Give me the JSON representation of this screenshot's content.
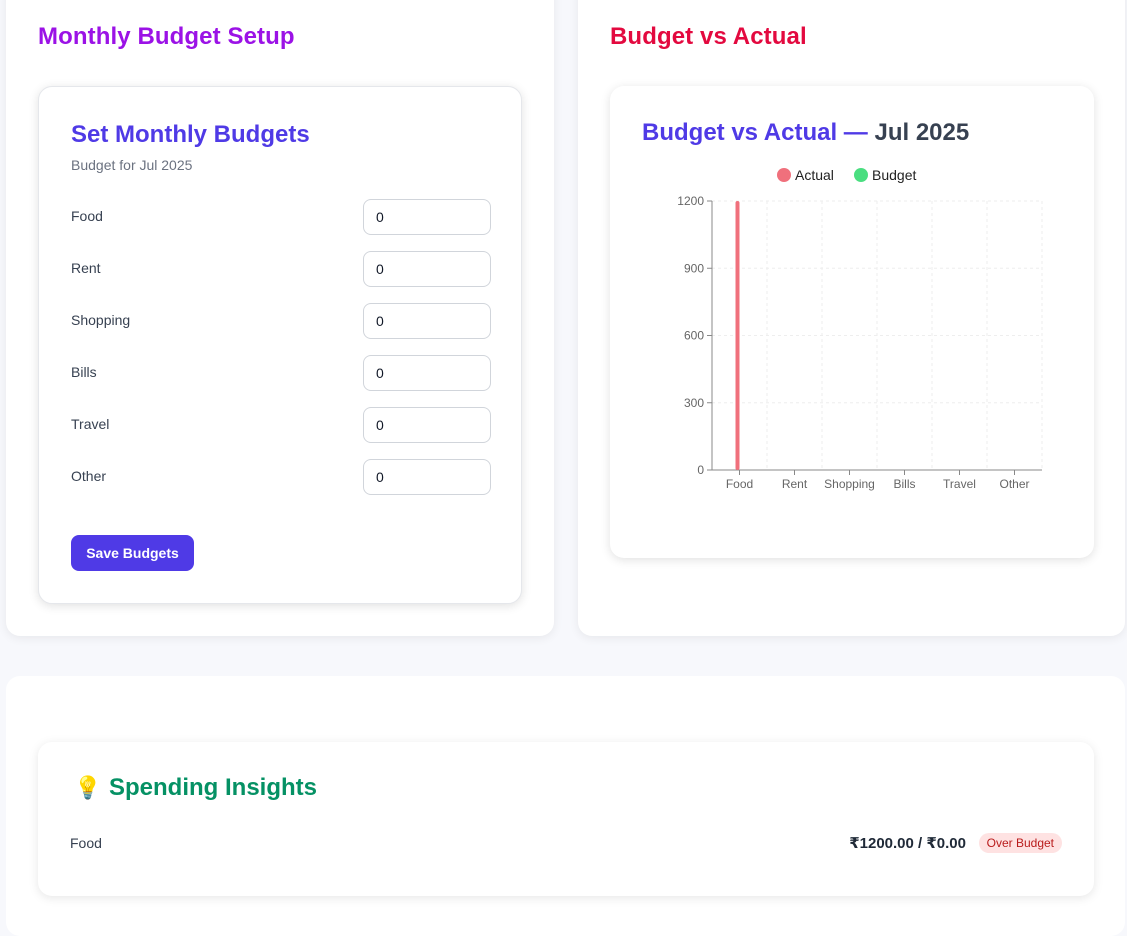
{
  "setup_panel": {
    "title": "Monthly Budget Setup",
    "card_title": "Set Monthly Budgets",
    "subtitle": "Budget for Jul 2025",
    "rows": [
      {
        "label": "Food",
        "value": "0"
      },
      {
        "label": "Rent",
        "value": "0"
      },
      {
        "label": "Shopping",
        "value": "0"
      },
      {
        "label": "Bills",
        "value": "0"
      },
      {
        "label": "Travel",
        "value": "0"
      },
      {
        "label": "Other",
        "value": "0"
      }
    ],
    "save_label": "Save Budgets"
  },
  "chart_panel": {
    "title": "Budget vs Actual",
    "card_title_main": "Budget vs Actual —",
    "card_title_month": "Jul 2025"
  },
  "insights": {
    "title": "Spending Insights",
    "icon": "lightbulb-icon",
    "items": [
      {
        "category": "Food",
        "amount": "₹1200.00 / ₹0.00",
        "status": "Over Budget"
      }
    ]
  },
  "colors": {
    "actual": "#f0707c",
    "budget": "#4ade80",
    "accent": "#4f3ae6"
  },
  "chart_data": {
    "type": "bar",
    "categories": [
      "Food",
      "Rent",
      "Shopping",
      "Bills",
      "Travel",
      "Other"
    ],
    "series": [
      {
        "name": "Actual",
        "values": [
          1200,
          0,
          0,
          0,
          0,
          0
        ]
      },
      {
        "name": "Budget",
        "values": [
          0,
          0,
          0,
          0,
          0,
          0
        ]
      }
    ],
    "ylim": [
      0,
      1200
    ],
    "yticks": [
      0,
      300,
      600,
      900,
      1200
    ],
    "legend": "top-center",
    "grid": true
  }
}
